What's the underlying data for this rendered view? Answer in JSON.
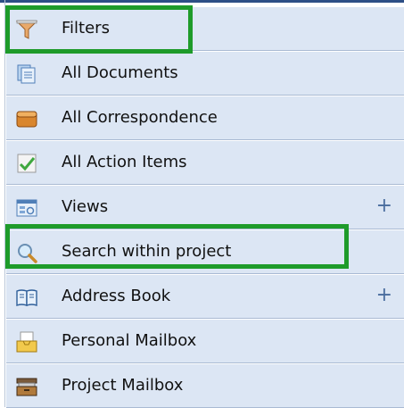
{
  "nav": {
    "items": [
      {
        "label": "Filters",
        "icon": "filter-icon",
        "expandable": false
      },
      {
        "label": "All Documents",
        "icon": "documents-icon",
        "expandable": false
      },
      {
        "label": "All Correspondence",
        "icon": "correspondence-icon",
        "expandable": false
      },
      {
        "label": "All Action Items",
        "icon": "checkmark-icon",
        "expandable": false
      },
      {
        "label": "Views",
        "icon": "views-icon",
        "expandable": true,
        "expand_symbol": "+"
      },
      {
        "label": "Search within project",
        "icon": "search-icon",
        "expandable": false
      },
      {
        "label": "Address Book",
        "icon": "address-book-icon",
        "expandable": true,
        "expand_symbol": "+"
      },
      {
        "label": "Personal Mailbox",
        "icon": "personal-mailbox-icon",
        "expandable": false
      },
      {
        "label": "Project Mailbox",
        "icon": "project-mailbox-icon",
        "expandable": false
      }
    ]
  },
  "colors": {
    "item_background": "#dce6f4",
    "item_border": "#a9bad3",
    "highlight": "#1e9b2a",
    "top_line": "#2d4f86"
  }
}
